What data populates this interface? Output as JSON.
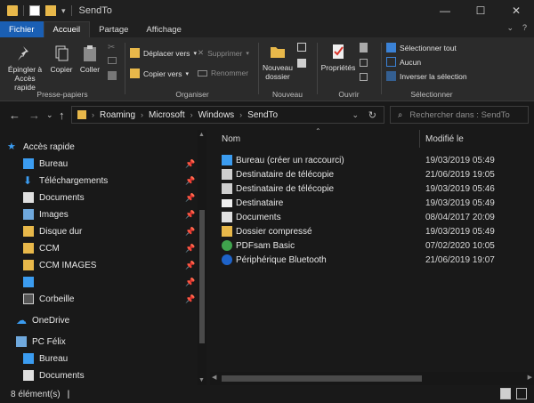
{
  "window": {
    "title": "SendTo"
  },
  "ribbon_tabs": [
    "Fichier",
    "Accueil",
    "Partage",
    "Affichage"
  ],
  "ribbon": {
    "pin_label": "Épingler à Accès rapide",
    "copy_label": "Copier",
    "paste_label": "Coller",
    "group_clipboard": "Presse-papiers",
    "move_label": "Déplacer vers",
    "copyto_label": "Copier vers",
    "delete_label": "Supprimer",
    "rename_label": "Renommer",
    "group_organize": "Organiser",
    "newfolder_label": "Nouveau dossier",
    "group_new": "Nouveau",
    "properties_label": "Propriétés",
    "group_open": "Ouvrir",
    "select_all_label": "Sélectionner tout",
    "select_none_label": "Aucun",
    "invert_label": "Inverser la sélection",
    "group_select": "Sélectionner"
  },
  "address": {
    "crumbs": [
      "Roaming",
      "Microsoft",
      "Windows",
      "SendTo"
    ]
  },
  "search": {
    "placeholder": "Rechercher dans : SendTo"
  },
  "nav": {
    "quick_access": "Accès rapide",
    "items": [
      {
        "label": "Bureau",
        "icon": "desktop-icon",
        "pinned": true
      },
      {
        "label": "Téléchargements",
        "icon": "download-icon",
        "pinned": true
      },
      {
        "label": "Documents",
        "icon": "documents-icon",
        "pinned": true
      },
      {
        "label": "Images",
        "icon": "images-icon",
        "pinned": true
      },
      {
        "label": "Disque dur",
        "icon": "folder-icon",
        "pinned": true
      },
      {
        "label": "CCM",
        "icon": "folder-icon",
        "pinned": true
      },
      {
        "label": "CCM IMAGES",
        "icon": "folder-icon",
        "pinned": true
      },
      {
        "label": "",
        "icon": "monitor-icon",
        "pinned": true
      },
      {
        "label": "Corbeille",
        "icon": "recycle-bin-icon",
        "pinned": true
      }
    ],
    "onedrive": "OneDrive",
    "pc": "PC Félix",
    "pc_items": [
      {
        "label": "Bureau",
        "icon": "desktop-icon"
      },
      {
        "label": "Documents",
        "icon": "documents-icon"
      }
    ]
  },
  "columns": {
    "name": "Nom",
    "modified": "Modifié le"
  },
  "files": [
    {
      "name": "Bureau (créer un raccourci)",
      "date": "19/03/2019 05:49",
      "icon": "desktop-shortcut-icon"
    },
    {
      "name": "Destinataire de télécopie",
      "date": "21/06/2019 19:05",
      "icon": "fax-icon"
    },
    {
      "name": "Destinataire de télécopie",
      "date": "19/03/2019 05:46",
      "icon": "fax-icon"
    },
    {
      "name": "Destinataire",
      "date": "19/03/2019 05:49",
      "icon": "mail-icon"
    },
    {
      "name": "Documents",
      "date": "08/04/2017 20:09",
      "icon": "documents-icon"
    },
    {
      "name": "Dossier compressé",
      "date": "19/03/2019 05:49",
      "icon": "zip-folder-icon"
    },
    {
      "name": "PDFsam Basic",
      "date": "07/02/2020 10:05",
      "icon": "pdfsam-icon"
    },
    {
      "name": "Périphérique Bluetooth",
      "date": "21/06/2019 19:07",
      "icon": "bluetooth-icon"
    }
  ],
  "status": {
    "count": "8 élément(s)"
  },
  "colors": {
    "accent": "#1a5fb4",
    "folder": "#e8b84a",
    "background": "#191919"
  }
}
